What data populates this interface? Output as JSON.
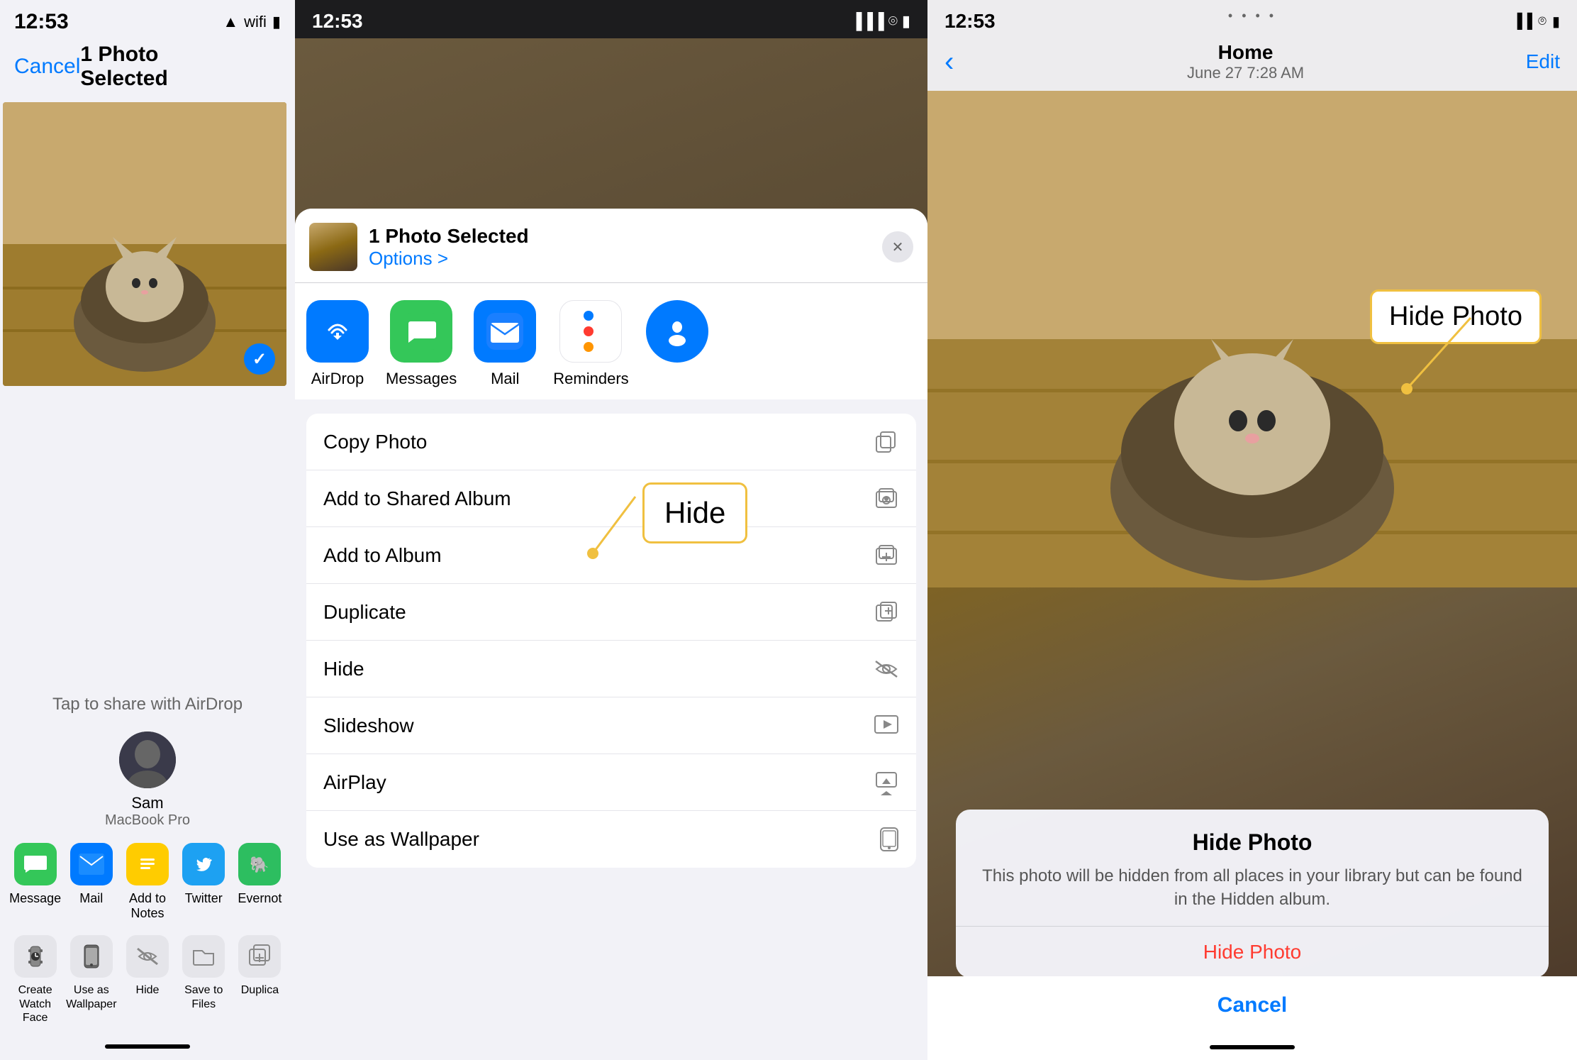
{
  "left_panel": {
    "status_time": "12:53",
    "cancel_label": "Cancel",
    "title": "1 Photo Selected",
    "airdrop_hint": "Tap to share with AirDrop",
    "avatar_name": "Sam",
    "avatar_sub": "MacBook Pro",
    "share_apps": [
      {
        "label": "Message",
        "color": "#34c759",
        "icon": "💬"
      },
      {
        "label": "Mail",
        "color": "#007aff",
        "icon": "✉️"
      },
      {
        "label": "Add to Notes",
        "color": "#ffcc00",
        "icon": "📝"
      },
      {
        "label": "Twitter",
        "color": "#1da1f2",
        "icon": "🐦"
      },
      {
        "label": "Evernot",
        "color": "#2dbe60",
        "icon": "🐘"
      }
    ],
    "actions": [
      {
        "label": "Create Watch Face",
        "icon": "⌚"
      },
      {
        "label": "Use as Wallpaper",
        "icon": "📱"
      },
      {
        "label": "Hide",
        "icon": "🚫"
      },
      {
        "label": "Save to Files",
        "icon": "📁"
      },
      {
        "label": "Duplica",
        "icon": "➕"
      }
    ]
  },
  "middle_panel": {
    "status_time": "12:53",
    "sheet_title": "1 Photo Selected",
    "sheet_options": "Options >",
    "apps": [
      {
        "label": "AirDrop",
        "type": "airdrop"
      },
      {
        "label": "Messages",
        "type": "messages"
      },
      {
        "label": "Mail",
        "type": "mail"
      },
      {
        "label": "Reminders",
        "type": "reminders"
      }
    ],
    "actions": [
      {
        "label": "Copy Photo",
        "icon": "⧉"
      },
      {
        "label": "Add to Shared Album",
        "icon": "👤"
      },
      {
        "label": "Add to Album",
        "icon": "➕"
      },
      {
        "label": "Duplicate",
        "icon": "⊞"
      },
      {
        "label": "Hide",
        "icon": "👁"
      },
      {
        "label": "Slideshow",
        "icon": "▶"
      },
      {
        "label": "AirPlay",
        "icon": "⬆"
      },
      {
        "label": "Use as Wallpaper",
        "icon": "📱"
      }
    ],
    "hide_callout": "Hide"
  },
  "right_panel": {
    "status_time": "12:53",
    "nav_back": "‹",
    "nav_title": "Home",
    "nav_subtitle": "June 27  7:28 AM",
    "nav_edit": "Edit",
    "alert_title": "Hide Photo",
    "alert_body": "This photo will be hidden from all places in your library but can be found in the Hidden album.",
    "alert_hide_label": "Hide Photo",
    "alert_cancel_label": "Cancel",
    "hide_photo_callout": "Hide Photo"
  }
}
